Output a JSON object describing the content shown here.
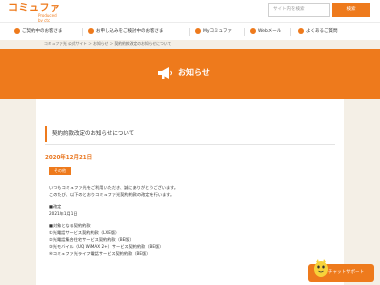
{
  "header": {
    "logo_text": "コミュファ",
    "logo_sub": "Produced by ctc",
    "search_placeholder": "サイト内を検索",
    "search_button": "検索"
  },
  "nav": {
    "items": [
      {
        "label": "ご契約中のお客さま"
      },
      {
        "label": "お申し込みをご検討中のお客さま"
      },
      {
        "label": "Myコミュファ"
      },
      {
        "label": "Webメール"
      },
      {
        "label": "よくあるご質問"
      }
    ]
  },
  "breadcrumb": {
    "text": "コミュファ光 公式サイト ＞ お知らせ ＞ 契約約款改定のお知らせについて"
  },
  "hero": {
    "title": "お知らせ"
  },
  "notice": {
    "heading": "契約約款改定のお知らせについて",
    "date": "2020年12月21日",
    "tag": "その他",
    "lines": [
      "いつもコミュファ光をご利用いただき、誠にありがとうございます。",
      "このたび、以下のとおりコミュファ光契約約款の改定を行います。",
      "",
      "■改定",
      "2021年1月1日",
      "",
      "■対象となる契約約款",
      "①光電話サービス契約約款（LXE版）",
      "②光電話集合住宅サービス契約約款（BE版）",
      "③光モバイル（UQ WiMAX 2+）サービス契約約款（BE版）",
      "④コミュファ光ライフ電話サービス契約約款（BE版）"
    ]
  },
  "chat": {
    "label": "チャットサポート"
  },
  "colors": {
    "brand_orange": "#ee7a1c",
    "background": "#f4efe6"
  }
}
